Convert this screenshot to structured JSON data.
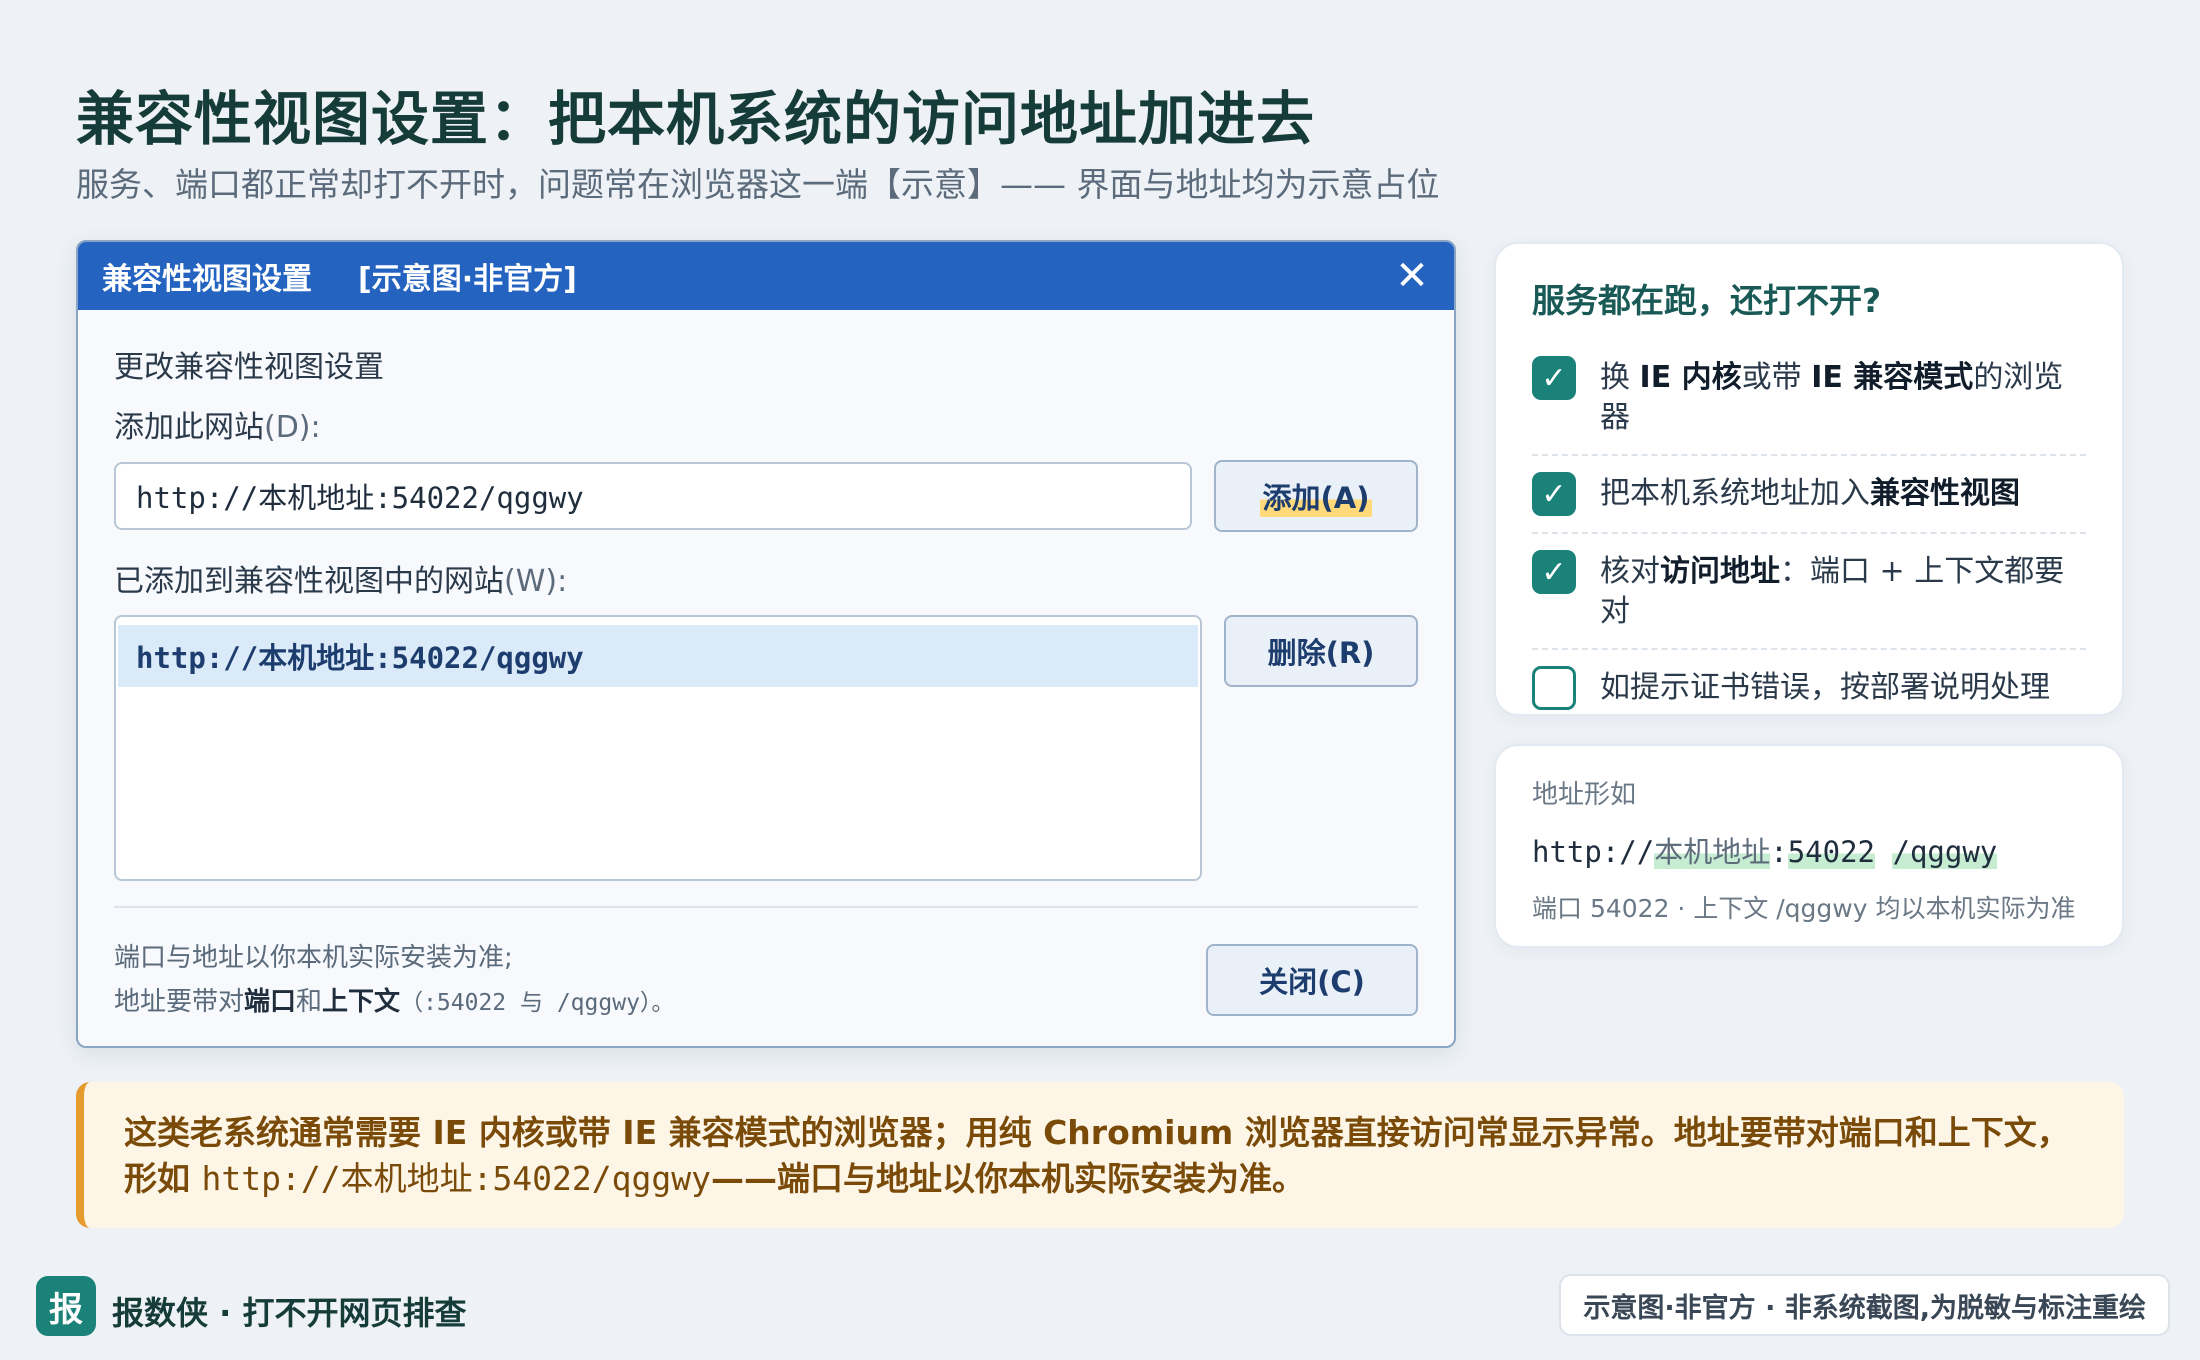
{
  "header": {
    "title": "兼容性视图设置：把本机系统的访问地址加进去",
    "subtitle": "服务、端口都正常却打不开时，问题常在浏览器这一端【示意】—— 界面与地址均为示意占位"
  },
  "dialog": {
    "title": "兼容性视图设置",
    "tag": "[示意图·非官方]",
    "heading": "更改兼容性视图设置",
    "add_label": "添加此网站",
    "add_shortcut": "(D):",
    "add_value": "http://本机地址:54022/qggwy",
    "add_button": "添加(A)",
    "list_label": "已添加到兼容性视图中的网站",
    "list_shortcut": "(W):",
    "sites": [
      "http://本机地址:54022/qggwy"
    ],
    "remove_button": "删除(R)",
    "note_line1": "端口与地址以你本机实际安装为准;",
    "note_line2_prefix": "地址要带对",
    "note_line2_bold1": "端口",
    "note_line2_mid": "和",
    "note_line2_bold2": "上下文",
    "note_line2_code": "（:54022 与 /qggwy）。",
    "close_button": "关闭(C)"
  },
  "checklist": {
    "title": "服务都在跑，还打不开?",
    "items": [
      {
        "checked": true,
        "parts": [
          "换 ",
          "IE 内核",
          "或带 ",
          "IE 兼容模式",
          "的浏览器"
        ]
      },
      {
        "checked": true,
        "parts": [
          "把本机系统地址加入",
          "兼容性视图"
        ]
      },
      {
        "checked": true,
        "parts": [
          "核对",
          "访问地址",
          "：端口 + 上下文都要对"
        ]
      },
      {
        "checked": false,
        "parts": [
          "如提示证书错误，按部署说明处理"
        ]
      }
    ],
    "check_glyph": "✓"
  },
  "address_example": {
    "label": "地址形如",
    "scheme": "http://",
    "host": "本机地址",
    "sep": ":",
    "port": "54022",
    "path": "/qggwy",
    "note": "端口 54022 · 上下文 /qggwy 均以本机实际为准"
  },
  "notice": {
    "text1": "这类老系统通常需要 IE 内核或带 IE 兼容模式的浏览器；用纯 Chromium 浏览器直接访问常显示异常。地址要带对端口和上下文，形如 ",
    "code": "http://本机地址:54022/qggwy",
    "text2": "——端口与地址以你本机实际安装为准。"
  },
  "footer": {
    "logo_char": "报",
    "brand": "报数侠 · 打不开网页排查",
    "badge": "示意图·非官方 · 非系统截图,为脱敏与标注重绘"
  },
  "colors": {
    "titlebar": "#2464c0",
    "accent_teal": "#1a8279",
    "notice_border": "#e69b2e",
    "notice_text": "#7a4a09"
  }
}
